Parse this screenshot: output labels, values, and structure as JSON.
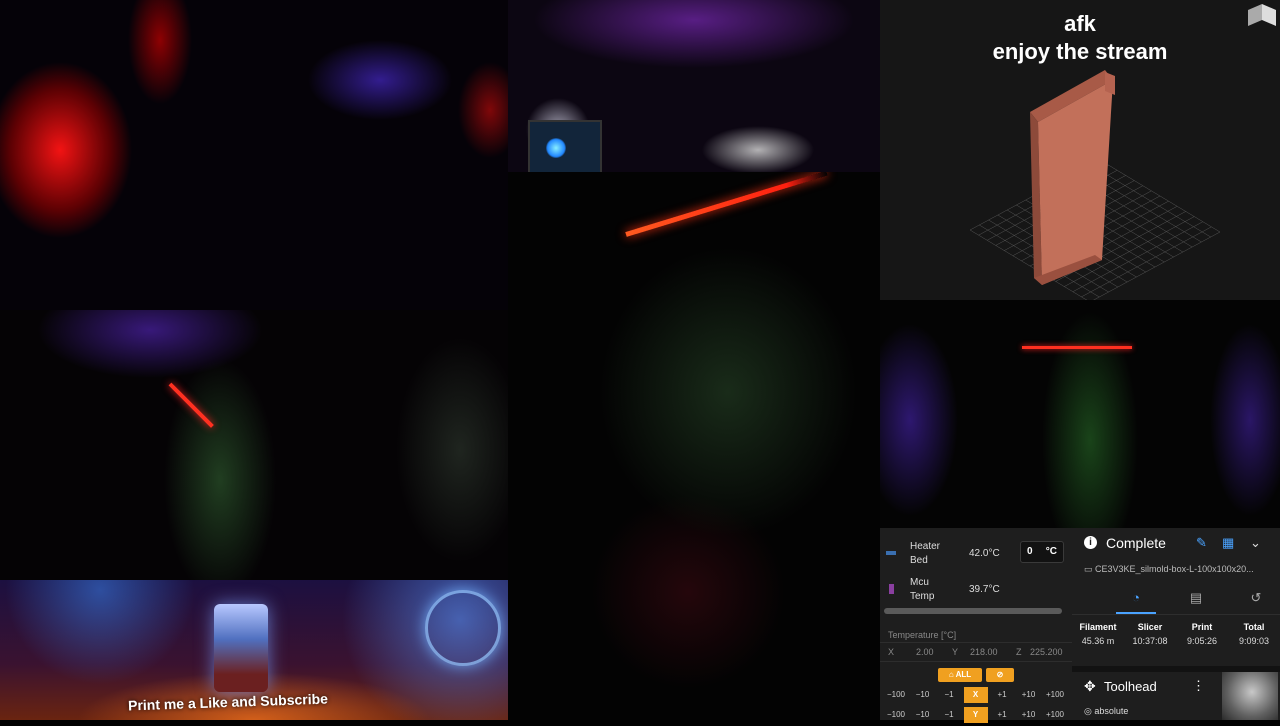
{
  "overlay": {
    "title_line1": "afk",
    "title_line2": "enjoy the stream"
  },
  "banner": {
    "caption": "Print me a Like and Subscribe"
  },
  "temperatures": [
    {
      "name_line1": "Heater",
      "name_line2": "Bed",
      "value": "42.0°C",
      "target": "0",
      "unit": "°C",
      "color": "#3a6fb0"
    },
    {
      "name_line1": "Mcu",
      "name_line2": "Temp",
      "value": "39.7°C",
      "color": "#8a3fa0"
    }
  ],
  "temperature_chart_label": "Temperature [°C]",
  "position": {
    "x_label": "X",
    "x_value": "2.00",
    "y_label": "Y",
    "y_value": "218.00",
    "z_label": "Z",
    "z_value": "225.200"
  },
  "homing": {
    "home_all_label": "ALL",
    "home_icon": "home-icon",
    "motors_off_icon": "motors-off-icon"
  },
  "jog": {
    "x_row": [
      "−100",
      "−10",
      "−1",
      "X",
      "+1",
      "+10",
      "+100"
    ],
    "y_row": [
      "−100",
      "−10",
      "−1",
      "Y",
      "+1",
      "+10",
      "+100"
    ]
  },
  "job": {
    "status": "Complete",
    "filename": "CE3V3KE_silmold-box-L-100x100x20...",
    "tabs": [
      "speedometer-icon",
      "file-icon",
      "history-icon"
    ],
    "times": [
      {
        "label": "Filament",
        "value": "45.36 m"
      },
      {
        "label": "Slicer",
        "value": "10:37:08"
      },
      {
        "label": "Print",
        "value": "9:05:26"
      },
      {
        "label": "Total",
        "value": "9:09:03"
      }
    ]
  },
  "toolhead": {
    "title": "Toolhead",
    "mode": "absolute"
  },
  "colors": {
    "accent": "#4aa3ff",
    "home_button": "#f0a020",
    "model": "#c2705a"
  }
}
